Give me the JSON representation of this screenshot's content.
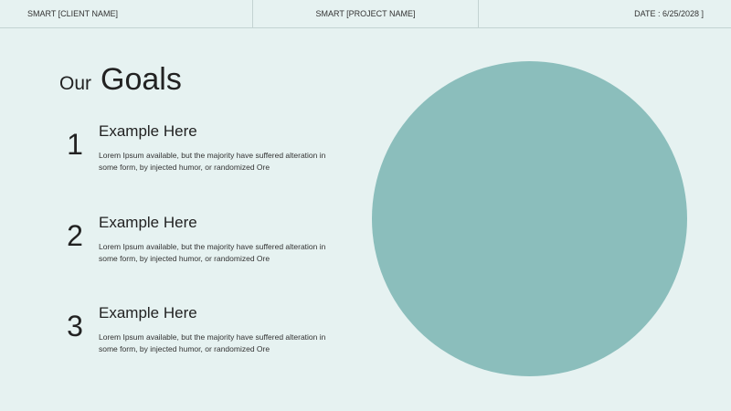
{
  "header": {
    "client": "SMART [CLIENT NAME]",
    "project": "SMART [PROJECT NAME]",
    "date": "DATE : 6/25/2028 ]"
  },
  "title": {
    "small": "Our",
    "big": "Goals"
  },
  "goals": [
    {
      "number": "1",
      "heading": "Example Here",
      "body": "Lorem Ipsum available, but the majority have suffered alteration in some form, by injected humor, or randomized Ore"
    },
    {
      "number": "2",
      "heading": "Example Here",
      "body": "Lorem Ipsum available, but the majority have suffered alteration in some form, by injected humor, or randomized Ore"
    },
    {
      "number": "3",
      "heading": "Example Here",
      "body": "Lorem Ipsum available, but the majority have suffered alteration in some form, by injected humor, or randomized Ore"
    }
  ],
  "colors": {
    "background": "#e6f2f1",
    "circle": "#8bbebc",
    "text": "#222222"
  }
}
